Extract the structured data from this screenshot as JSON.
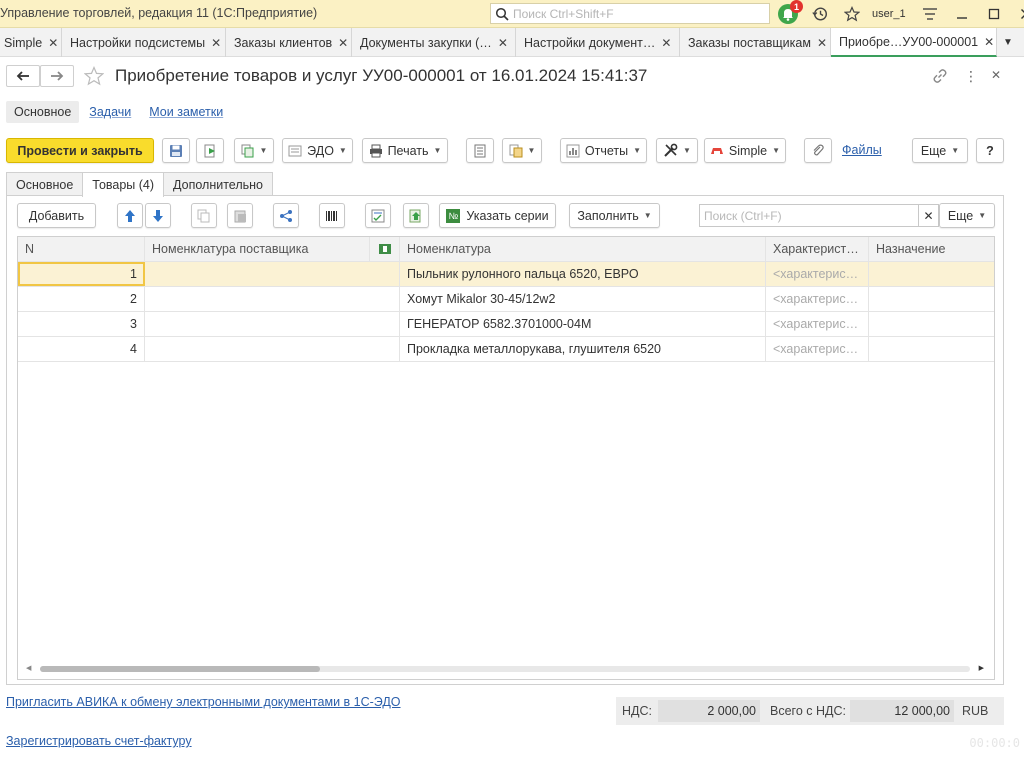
{
  "app": {
    "title": "Управление торговлей, редакция 11  (1С:Предприятие)",
    "search_placeholder": "Поиск Ctrl+Shift+F",
    "notifications_count": "1",
    "user": "user_1"
  },
  "tabs": [
    {
      "label": "Simple"
    },
    {
      "label": "Настройки подсистемы"
    },
    {
      "label": "Заказы клиентов"
    },
    {
      "label": "Документы закупки (…"
    },
    {
      "label": "Настройки документ…"
    },
    {
      "label": "Заказы поставщикам"
    },
    {
      "label": "Приобре…УУ00-000001"
    }
  ],
  "document": {
    "title": "Приобретение товаров и услуг УУ00-000001 от 16.01.2024 15:41:37"
  },
  "sections": {
    "main": "Основное",
    "tasks": "Задачи",
    "notes": "Мои заметки"
  },
  "toolbar": {
    "post_close": "Провести и закрыть",
    "edo": "ЭДО",
    "print": "Печать",
    "reports": "Отчеты",
    "simple": "Simple",
    "files": "Файлы",
    "more": "Еще",
    "help": "?"
  },
  "form_tabs": {
    "main": "Основное",
    "goods": "Товары (4)",
    "extra": "Дополнительно"
  },
  "goods_toolbar": {
    "add": "Добавить",
    "series": "Указать серии",
    "fill": "Заполнить",
    "search_placeholder": "Поиск (Ctrl+F)",
    "more": "Еще"
  },
  "grid": {
    "headers": {
      "n": "N",
      "supplier_item": "Номенклатура поставщика",
      "item": "Номенклатура",
      "characteristic": "Характерист…",
      "purpose": "Назначение"
    },
    "rows": [
      {
        "n": "1",
        "supplier_item": "",
        "item": "Пыльник рулонного пальца 6520, ЕВРО",
        "characteristic": "<характерис…",
        "purpose": ""
      },
      {
        "n": "2",
        "supplier_item": "",
        "item": "Хомут Mikalor 30-45/12w2",
        "characteristic": "<характерис…",
        "purpose": ""
      },
      {
        "n": "3",
        "supplier_item": "",
        "item": "ГЕНЕРАТОР 6582.3701000-04М",
        "characteristic": "<характерис…",
        "purpose": ""
      },
      {
        "n": "4",
        "supplier_item": "",
        "item": "Прокладка металлорукава, глушителя 6520",
        "characteristic": "<характерис…",
        "purpose": ""
      }
    ]
  },
  "footer": {
    "invite_link": "Пригласить АВИКА к обмену электронными документами в 1С-ЭДО",
    "invoice_link": "Зарегистрировать счет-фактуру",
    "vat_label": "НДС:",
    "vat_value": "2 000,00",
    "total_label": "Всего с НДС:",
    "total_value": "12 000,00",
    "currency": "RUB",
    "timer": "00:00:0"
  }
}
